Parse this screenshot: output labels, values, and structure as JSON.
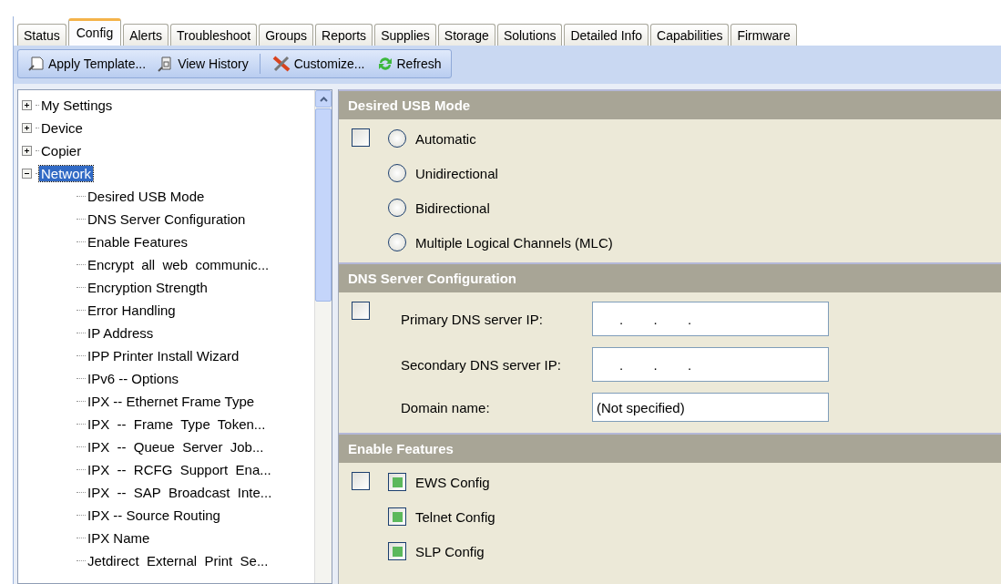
{
  "tabs": [
    {
      "label": "Status",
      "selected": false
    },
    {
      "label": "Config",
      "selected": true
    },
    {
      "label": "Alerts",
      "selected": false
    },
    {
      "label": "Troubleshoot",
      "selected": false
    },
    {
      "label": "Groups",
      "selected": false
    },
    {
      "label": "Reports",
      "selected": false
    },
    {
      "label": "Supplies",
      "selected": false
    },
    {
      "label": "Storage",
      "selected": false
    },
    {
      "label": "Solutions",
      "selected": false
    },
    {
      "label": "Detailed Info",
      "selected": false
    },
    {
      "label": "Capabilities",
      "selected": false
    },
    {
      "label": "Firmware",
      "selected": false
    }
  ],
  "toolbar": [
    {
      "label": "Apply Template...",
      "kind": "template"
    },
    {
      "label": "View History",
      "kind": "history"
    },
    {
      "label": "Customize...",
      "kind": "customize"
    },
    {
      "label": "Refresh",
      "kind": "refresh"
    }
  ],
  "tree": [
    {
      "label": "My Settings",
      "expanded": false,
      "selected": false
    },
    {
      "label": "Device",
      "expanded": false,
      "selected": false
    },
    {
      "label": "Copier",
      "expanded": false,
      "selected": false
    },
    {
      "label": "Network",
      "expanded": true,
      "selected": true,
      "children": [
        {
          "label": "Desired USB Mode"
        },
        {
          "label": "DNS Server Configuration"
        },
        {
          "label": "Enable Features"
        },
        {
          "label": "Encrypt  all  web  communic..."
        },
        {
          "label": "Encryption Strength"
        },
        {
          "label": "Error Handling"
        },
        {
          "label": "IP Address"
        },
        {
          "label": "IPP Printer Install Wizard"
        },
        {
          "label": "IPv6 -- Options"
        },
        {
          "label": "IPX -- Ethernet Frame Type"
        },
        {
          "label": "IPX  --  Frame  Type  Token..."
        },
        {
          "label": "IPX  --  Queue  Server  Job..."
        },
        {
          "label": "IPX  --  RCFG  Support  Ena..."
        },
        {
          "label": "IPX  --  SAP  Broadcast  Inte..."
        },
        {
          "label": "IPX -- Source Routing"
        },
        {
          "label": "IPX Name"
        },
        {
          "label": "Jetdirect  External  Print  Se..."
        }
      ]
    }
  ],
  "sections": [
    {
      "title": "Desired USB Mode",
      "kind": "radios",
      "checked": false,
      "options": [
        {
          "label": "Automatic",
          "selected": false
        },
        {
          "label": "Unidirectional",
          "selected": false
        },
        {
          "label": "Bidirectional",
          "selected": false
        },
        {
          "label": "Multiple Logical Channels (MLC)",
          "selected": false
        }
      ]
    },
    {
      "title": "DNS Server Configuration",
      "kind": "fields",
      "checked": false,
      "fields": [
        {
          "label": "Primary DNS server IP:",
          "kind": "ip",
          "value": "      .        .        ."
        },
        {
          "label": "Secondary DNS server IP:",
          "kind": "ip",
          "value": "      .        .        ."
        },
        {
          "label": "Domain name:",
          "kind": "text",
          "value": "(Not specified)"
        }
      ]
    },
    {
      "title": "Enable Features",
      "kind": "checks",
      "checked": false,
      "options": [
        {
          "label": "EWS Config",
          "checked": true
        },
        {
          "label": "Telnet Config",
          "checked": true
        },
        {
          "label": "SLP Config",
          "checked": true
        }
      ]
    }
  ]
}
